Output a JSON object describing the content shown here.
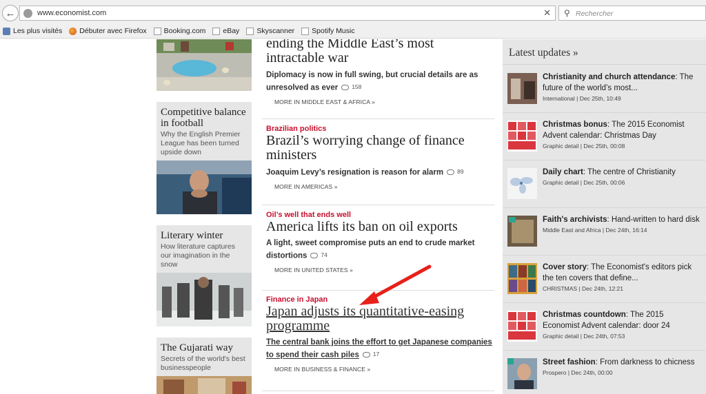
{
  "browser": {
    "url": "www.economist.com",
    "search_placeholder": "Rechercher",
    "bookmarks": [
      {
        "label": "Les plus visités"
      },
      {
        "label": "Débuter avec Firefox"
      },
      {
        "label": "Booking.com"
      },
      {
        "label": "eBay"
      },
      {
        "label": "Skyscanner"
      },
      {
        "label": "Spotify Music"
      }
    ]
  },
  "left_column": [
    {
      "title": "Competitive balance in football",
      "text": "Why the English Premier League has been turned upside down"
    },
    {
      "title": "Literary winter",
      "text": "How literature captures our imagination in the snow"
    },
    {
      "title": "The Gujarati way",
      "text": "Secrets of the world's best businesspeople"
    }
  ],
  "stories": [
    {
      "flag": "",
      "title": "ending the Middle East’s most intractable war",
      "desc": "Diplomacy is now in full swing, but crucial details are as unresolved as ever",
      "comments": "158",
      "more": "MORE IN MIDDLE EAST & AFRICA »"
    },
    {
      "flag": "Brazilian politics",
      "title": "Brazil’s worrying change of finance ministers",
      "desc": "Joaquim Levy’s resignation is reason for alarm",
      "comments": "89",
      "more": "MORE IN AMERICAS »"
    },
    {
      "flag": "Oil’s well that ends well",
      "title": "America lifts its ban on oil exports",
      "desc": "A light, sweet compromise puts an end to crude market distortions",
      "comments": "74",
      "more": "MORE IN UNITED STATES »"
    },
    {
      "flag": "Finance in Japan",
      "title": "Japan adjusts its quantitative-easing programme",
      "desc": "The central bank joins the effort to get Japanese companies to spend their cash piles",
      "comments": "17",
      "more": "MORE IN BUSINESS & FINANCE »"
    }
  ],
  "latest_updates": {
    "title": "Latest updates »",
    "items": [
      {
        "bold": "Christianity and church attendance",
        "rest": ": The future of the world’s most...",
        "meta": "International | Dec 25th, 10:49"
      },
      {
        "bold": "Christmas bonus",
        "rest": ": The 2015 Economist Advent calendar: Christmas Day",
        "meta": "Graphic detail | Dec 25th, 00:08"
      },
      {
        "bold": "Daily chart",
        "rest": ": The centre of Christianity",
        "meta": "Graphic detail | Dec 25th, 00:06"
      },
      {
        "bold": "Faith's archivists",
        "rest": ": Hand-written to hard disk",
        "meta": "Middle East and Africa | Dec 24th, 16:14"
      },
      {
        "bold": "Cover story",
        "rest": ": The Economist's editors pick the ten covers that define...",
        "meta": "CHRISTMAS | Dec 24th, 12:21"
      },
      {
        "bold": "Christmas countdown",
        "rest": ": The 2015 Economist Advent calendar: door 24",
        "meta": "Graphic detail | Dec 24th, 07:53"
      },
      {
        "bold": "Street fashion",
        "rest": ": From darkness to chicness",
        "meta": "Prospero | Dec 24th, 00:00"
      }
    ]
  },
  "colors": {
    "flag_red": "#c8102e",
    "arrow_red": "#e8201a",
    "sidebar_bg": "#e6e6e6"
  }
}
